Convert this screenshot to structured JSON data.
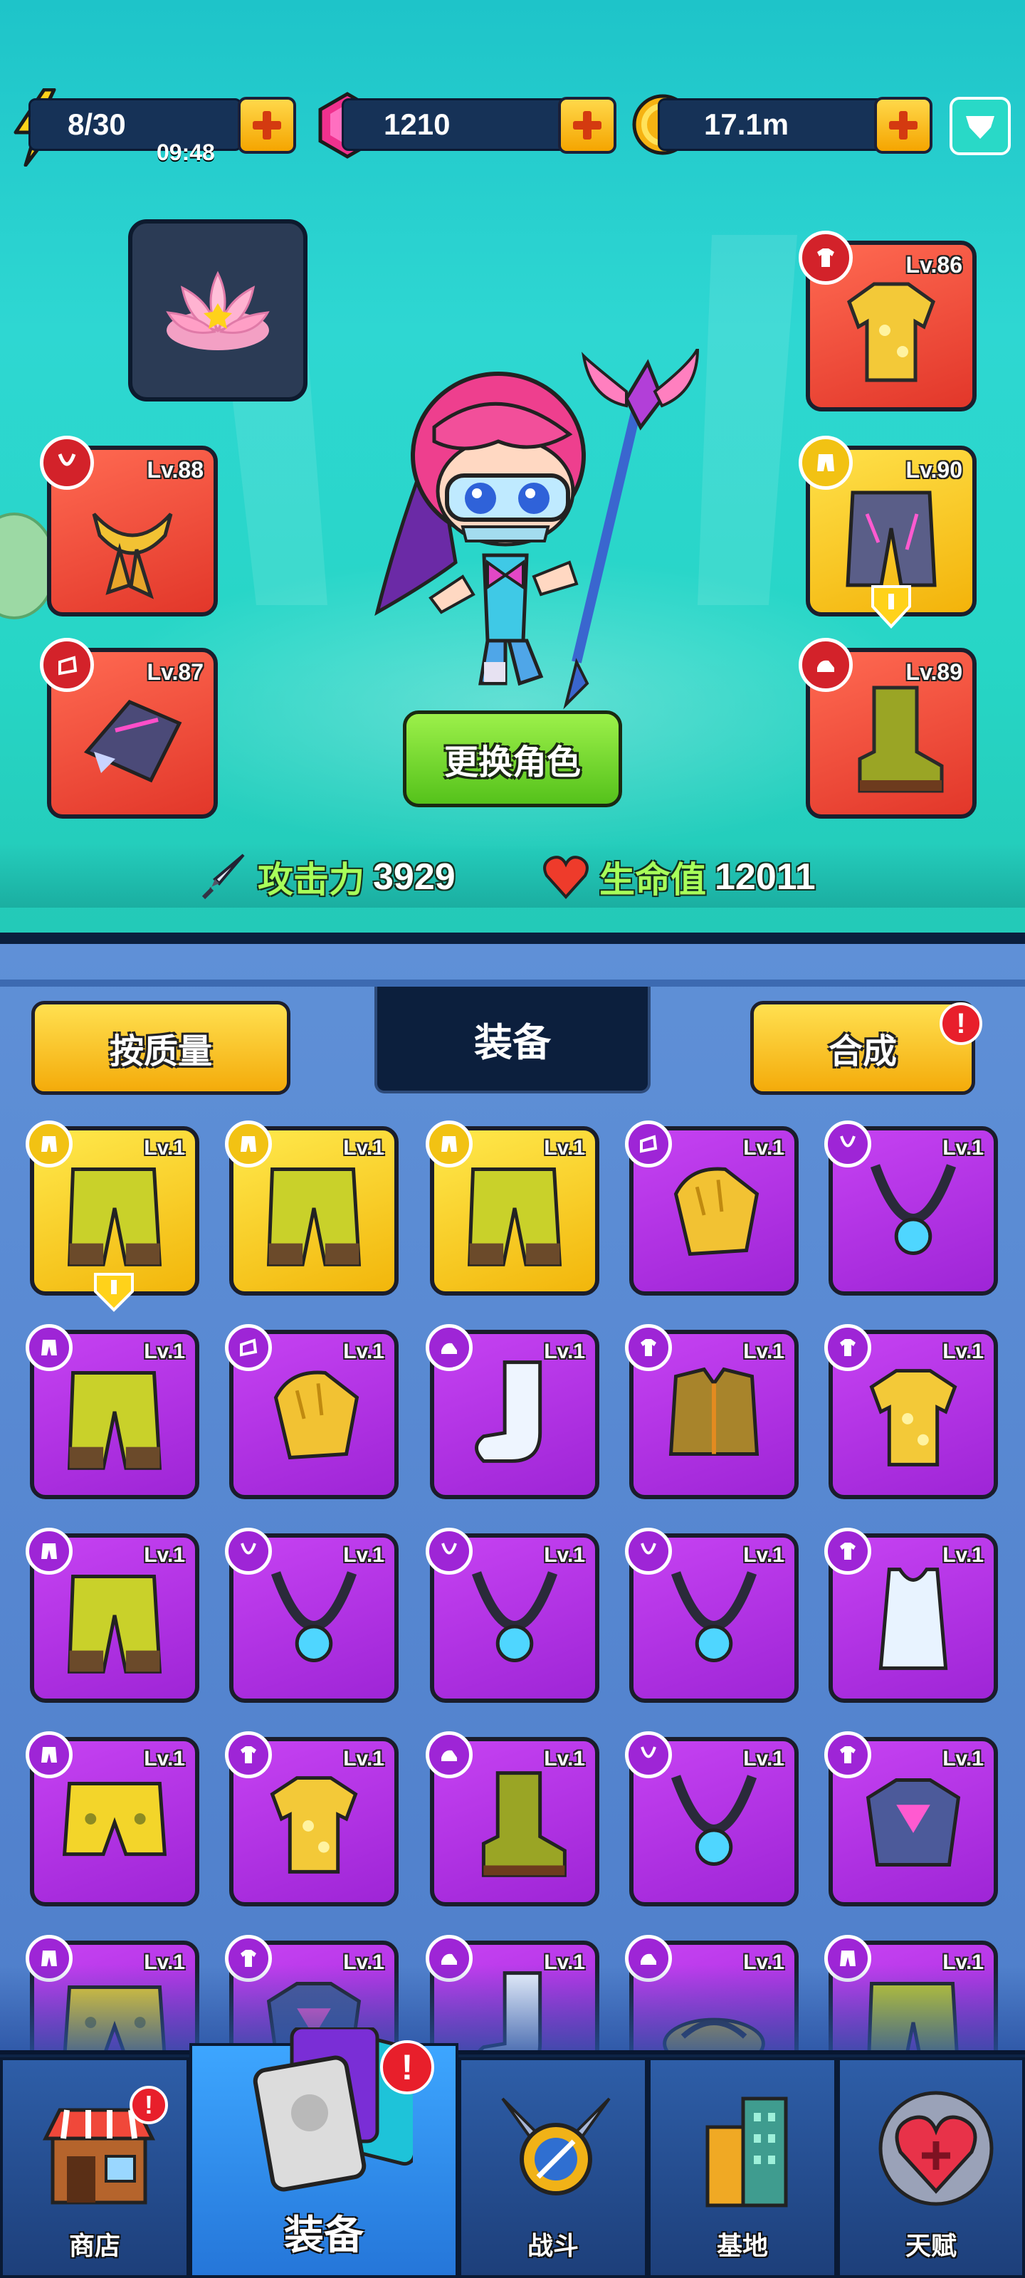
{
  "resources": {
    "energy": {
      "value": "8/30",
      "timer": "09:48"
    },
    "gems": {
      "value": "1210"
    },
    "coins": {
      "value": "17.1m"
    }
  },
  "hero": {
    "change_character_label": "更换角色",
    "attack_label": "攻击力",
    "attack_value": "3929",
    "hp_label": "生命值",
    "hp_value": "12011"
  },
  "equipped": {
    "necklace": {
      "level": "Lv.88"
    },
    "gloves": {
      "level": "Lv.87"
    },
    "shirt": {
      "level": "Lv.86"
    },
    "pants": {
      "level": "Lv.90"
    },
    "boots": {
      "level": "Lv.89"
    }
  },
  "inventory": {
    "sort_label": "按质量",
    "title": "装备",
    "merge_label": "合成",
    "merge_alert": "!",
    "items": [
      {
        "level": "Lv.1",
        "rarity": "gold",
        "type": "pants",
        "icon": "pants-icon"
      },
      {
        "level": "Lv.1",
        "rarity": "gold",
        "type": "pants",
        "icon": "pants-icon"
      },
      {
        "level": "Lv.1",
        "rarity": "gold",
        "type": "pants",
        "icon": "pants-icon"
      },
      {
        "level": "Lv.1",
        "rarity": "purple",
        "type": "gloves",
        "icon": "glove-icon"
      },
      {
        "level": "Lv.1",
        "rarity": "purple",
        "type": "necklace",
        "icon": "necklace-icon"
      },
      {
        "level": "Lv.1",
        "rarity": "purple",
        "type": "pants",
        "icon": "pants-icon"
      },
      {
        "level": "Lv.1",
        "rarity": "purple",
        "type": "gloves",
        "icon": "glove-icon"
      },
      {
        "level": "Lv.1",
        "rarity": "purple",
        "type": "boots",
        "icon": "sock-icon"
      },
      {
        "level": "Lv.1",
        "rarity": "purple",
        "type": "shirt",
        "icon": "vest-icon"
      },
      {
        "level": "Lv.1",
        "rarity": "purple",
        "type": "shirt",
        "icon": "shirt-icon"
      },
      {
        "level": "Lv.1",
        "rarity": "purple",
        "type": "pants",
        "icon": "pants-icon"
      },
      {
        "level": "Lv.1",
        "rarity": "purple",
        "type": "necklace",
        "icon": "necklace-icon"
      },
      {
        "level": "Lv.1",
        "rarity": "purple",
        "type": "necklace",
        "icon": "necklace-icon"
      },
      {
        "level": "Lv.1",
        "rarity": "purple",
        "type": "necklace",
        "icon": "necklace-icon"
      },
      {
        "level": "Lv.1",
        "rarity": "purple",
        "type": "shirt",
        "icon": "tank-top-icon"
      },
      {
        "level": "Lv.1",
        "rarity": "purple",
        "type": "pants",
        "icon": "shorts-icon"
      },
      {
        "level": "Lv.1",
        "rarity": "purple",
        "type": "shirt",
        "icon": "shirt-icon"
      },
      {
        "level": "Lv.1",
        "rarity": "purple",
        "type": "boots",
        "icon": "boot-icon"
      },
      {
        "level": "Lv.1",
        "rarity": "purple",
        "type": "necklace",
        "icon": "necklace-icon"
      },
      {
        "level": "Lv.1",
        "rarity": "purple",
        "type": "shirt",
        "icon": "armor-icon"
      },
      {
        "level": "Lv.1",
        "rarity": "purple",
        "type": "pants",
        "icon": "shorts-icon"
      },
      {
        "level": "Lv.1",
        "rarity": "purple",
        "type": "shirt",
        "icon": "armor-icon"
      },
      {
        "level": "Lv.1",
        "rarity": "purple",
        "type": "boots",
        "icon": "sock-icon"
      },
      {
        "level": "Lv.1",
        "rarity": "purple",
        "type": "boots",
        "icon": "sandal-icon"
      },
      {
        "level": "Lv.1",
        "rarity": "purple",
        "type": "pants",
        "icon": "pants-icon"
      }
    ]
  },
  "nav": {
    "shop": "商店",
    "equipment": "装备",
    "battle": "战斗",
    "base": "基地",
    "talent": "天赋",
    "alert": "!"
  },
  "colors": {
    "hero_bg": "#27d6c6",
    "inventory_bg": "#5f90d7",
    "purple_card": "#b43ae6",
    "gold_card": "#f7c820",
    "red_slot": "#ef4b3a",
    "nav_active": "#2f8fec"
  }
}
